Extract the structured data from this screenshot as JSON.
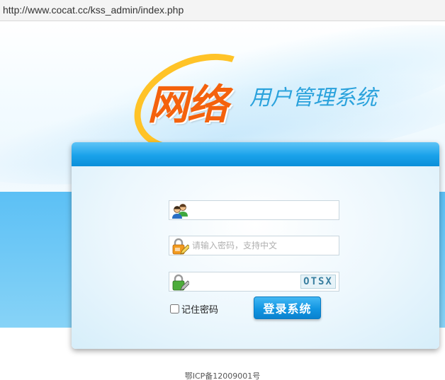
{
  "browser": {
    "url": "http://www.cocat.cc/kss_admin/index.php"
  },
  "logo": {
    "main": "网络",
    "sub": "用户管理系统"
  },
  "form": {
    "username": {
      "value": "",
      "placeholder": ""
    },
    "password": {
      "value": "",
      "placeholder": "请输入密码，支持中文"
    },
    "captcha_input": {
      "value": "",
      "placeholder": ""
    },
    "captcha_text": "OTSX",
    "remember_label": "记住密码",
    "remember_checked": false,
    "login_label": "登录系统"
  },
  "icons": {
    "username": "users-icon",
    "password": "lock-edit-icon",
    "captcha": "lock-check-icon"
  },
  "colors": {
    "accent": "#1aa2ea",
    "logo_orange": "#f4620d",
    "logo_ring": "#ffc327",
    "logo_sub": "#2aa2dc"
  },
  "footer": {
    "icp": "鄂ICP备12009001号"
  }
}
